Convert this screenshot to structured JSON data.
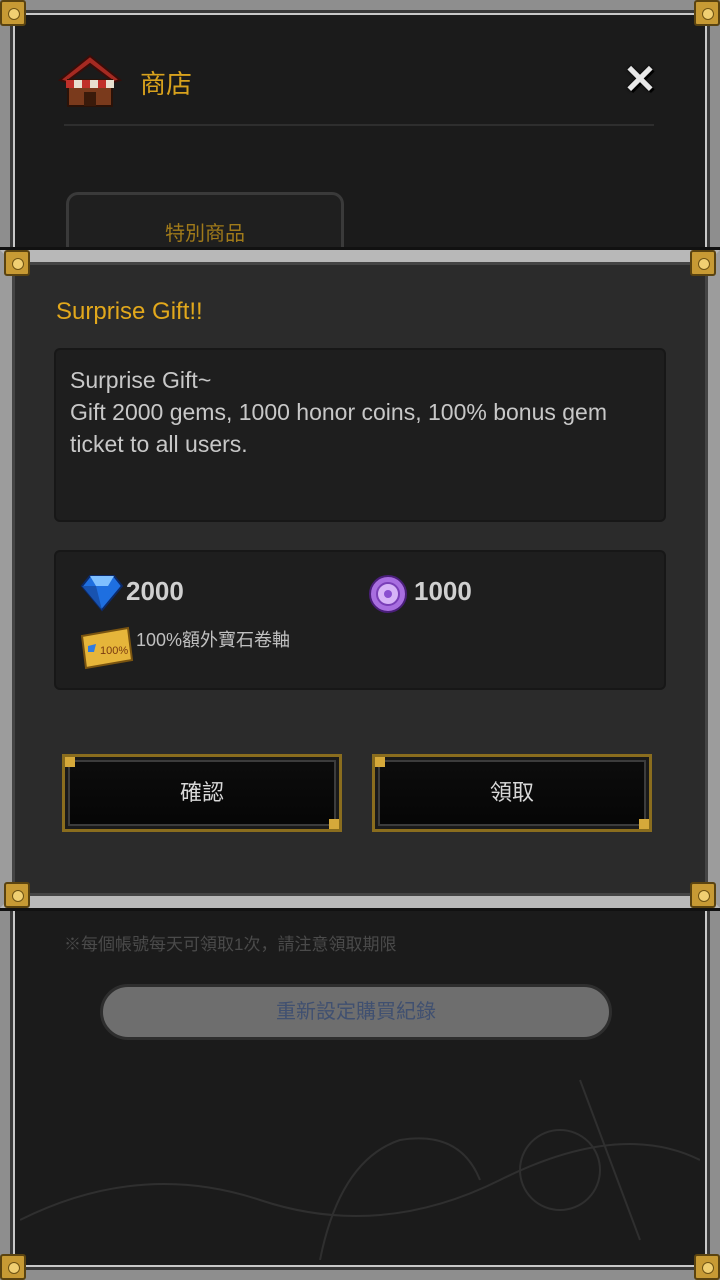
{
  "header": {
    "title": "商店",
    "close_icon": "close-icon"
  },
  "tabs": [
    {
      "label": "特別商品"
    }
  ],
  "footer": {
    "note": "※每個帳號每天可領取1次，請注意領取期限",
    "button_label": "重新設定購買紀錄"
  },
  "dialog": {
    "title": "Surprise Gift!!",
    "message_lines": [
      "Surprise Gift~",
      "Gift 2000 gems, 1000 honor coins, 100% bonus gem ticket to all users."
    ],
    "rewards": {
      "gems": "2000",
      "honor_coins": "1000",
      "ticket_label": "100%額外寶石卷軸"
    },
    "buttons": {
      "left": "確認",
      "right": "領取"
    }
  },
  "colors": {
    "accent": "#e2a81c",
    "frame": "#9c9c9c",
    "panel": "#2b2b2b"
  }
}
